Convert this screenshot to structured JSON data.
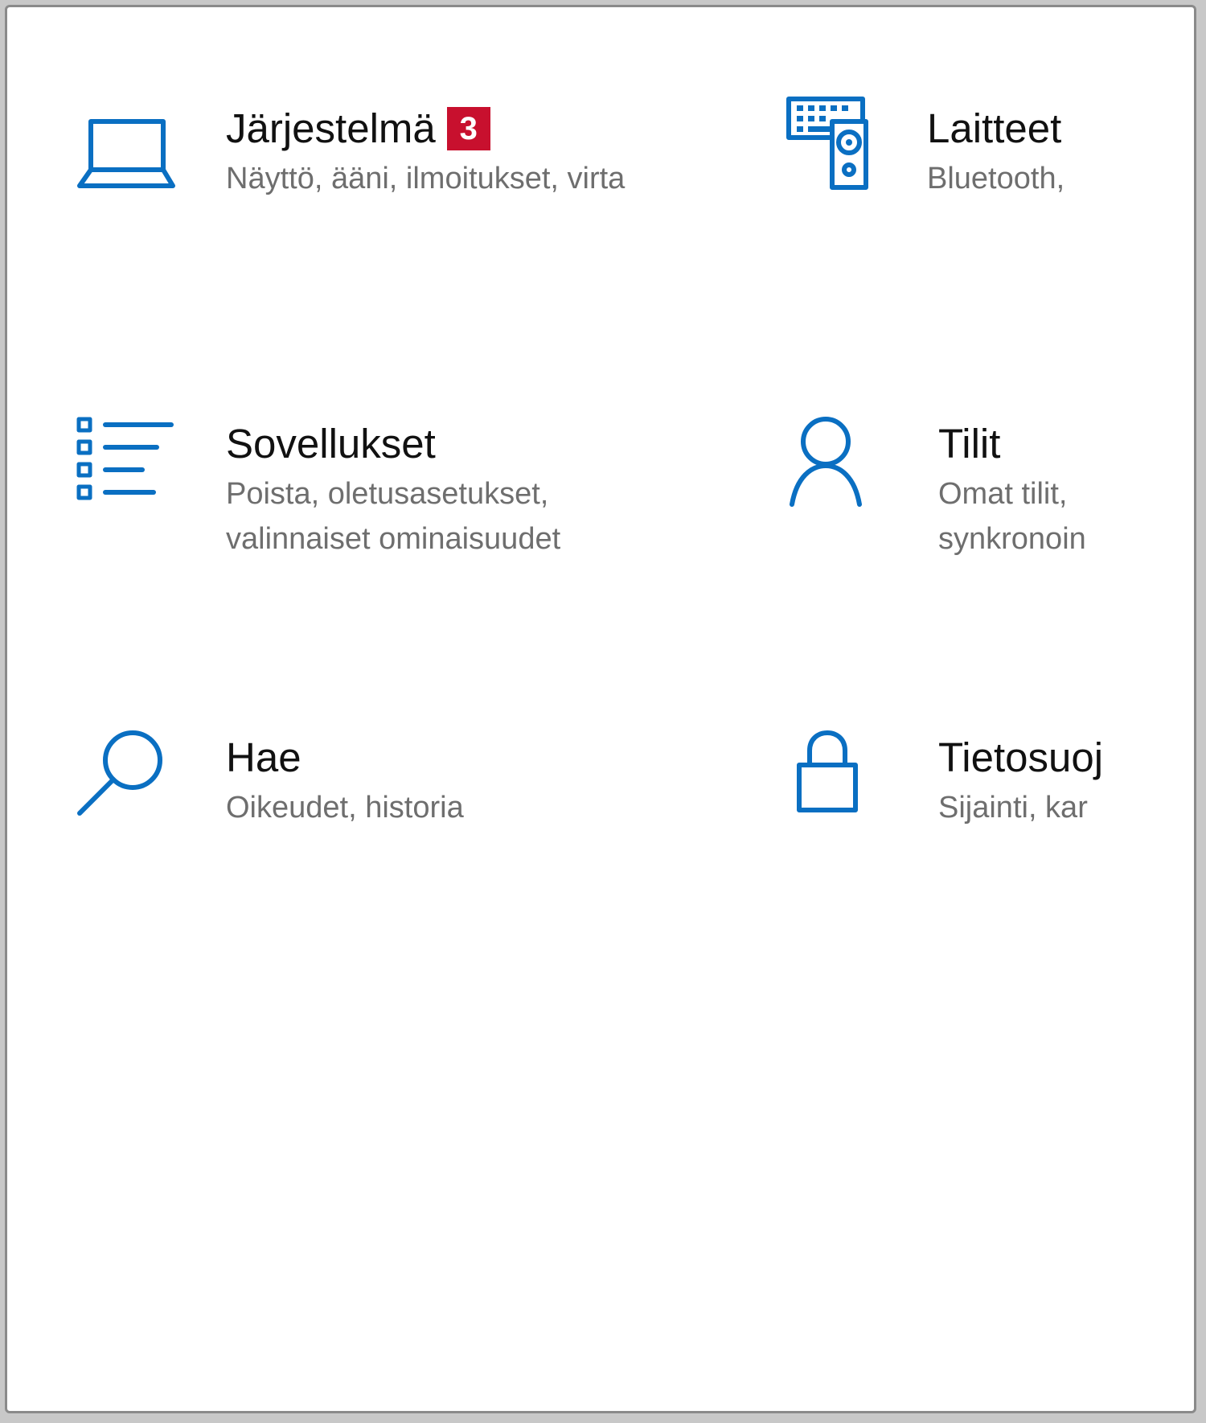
{
  "accent_color": "#0a6fc2",
  "badge_color": "#c8102e",
  "tiles": [
    {
      "title": "Järjestelmä",
      "badge": "3",
      "desc": [
        "Näyttö, ääni, ilmoitukset, virta"
      ],
      "icon": "laptop-icon"
    },
    {
      "title": "Laitteet",
      "desc": [
        "Bluetooth,"
      ],
      "icon": "devices-icon"
    },
    {
      "title": "Sovellukset",
      "desc": [
        "Poista, oletusasetukset,",
        "valinnaiset ominaisuudet"
      ],
      "icon": "apps-list-icon"
    },
    {
      "title": "Tilit",
      "desc": [
        "Omat tilit, ",
        "synkronoin"
      ],
      "icon": "person-icon"
    },
    {
      "title": "Hae",
      "desc": [
        "Oikeudet, historia"
      ],
      "icon": "search-icon"
    },
    {
      "title": "Tietosuoj",
      "desc": [
        "Sijainti, kar"
      ],
      "icon": "lock-icon"
    }
  ]
}
